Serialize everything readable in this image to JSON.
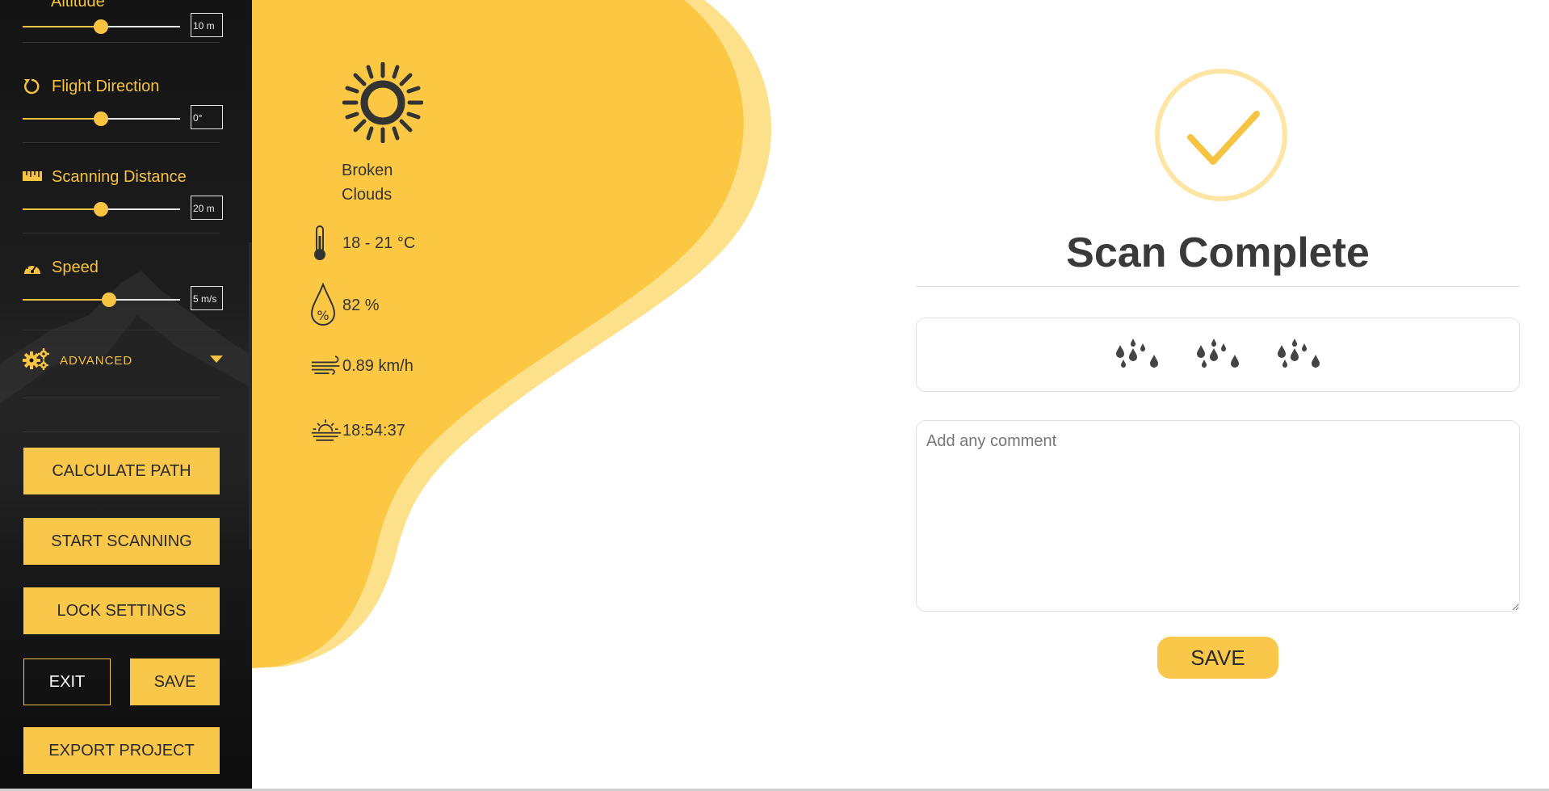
{
  "colors": {
    "accent": "#f9c74a",
    "sidebar_bg": "#141414",
    "text_dark": "#333333"
  },
  "sidebar": {
    "partial_label": "Altitude",
    "settings": [
      {
        "label": "",
        "value": "10 m",
        "level": 0.5,
        "icon": "altitude-icon"
      },
      {
        "label": "Flight Direction",
        "value": "0°",
        "level": 0.5,
        "icon": "rotate-icon"
      },
      {
        "label": "Scanning Distance",
        "value": "20 m",
        "level": 0.5,
        "icon": "ruler-icon"
      },
      {
        "label": "Speed",
        "value": "5 m/s",
        "level": 0.55,
        "icon": "speedometer-icon"
      }
    ],
    "advanced_label": "ADVANCED",
    "buttons": {
      "calculate": "CALCULATE PATH",
      "start": "START SCANNING",
      "lock": "LOCK SETTINGS",
      "exit": "EXIT",
      "save": "SAVE",
      "export": "EXPORT PROJECT"
    }
  },
  "weather": {
    "icon": "sun-icon",
    "description": "Broken Clouds",
    "temperature": "18 - 21 °C",
    "humidity": "82 %",
    "wind": "0.89 km/h",
    "sunset": "18:54:37"
  },
  "main": {
    "title": "Scan Complete",
    "rating_icons": [
      "rain-icon",
      "rain-icon",
      "rain-icon"
    ],
    "comment_placeholder": "Add any comment",
    "save_label": "SAVE"
  }
}
